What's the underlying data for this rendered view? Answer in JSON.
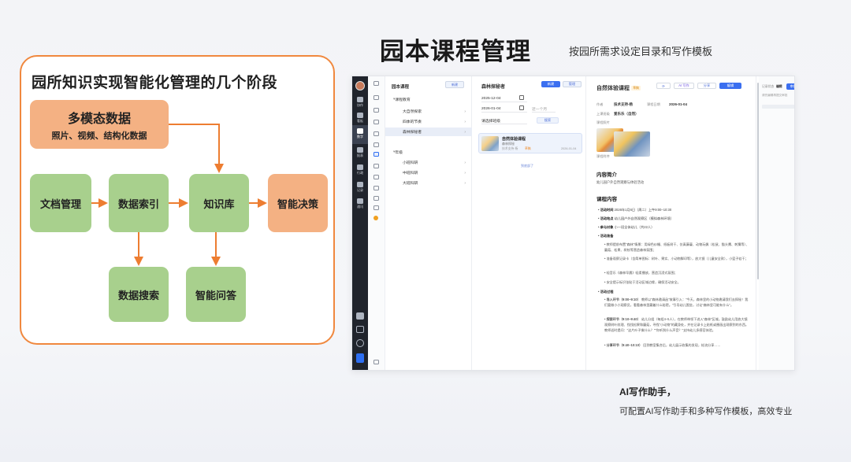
{
  "left_panel": {
    "title": "园所知识实现智能化管理的几个阶段",
    "nodes": {
      "multimodal": {
        "title": "多模态数据",
        "subtitle": "照片、视频、结构化数据"
      },
      "doc_mgmt": "文档管理",
      "data_index": "数据索引",
      "knowledge_base": "知识库",
      "smart_decision": "智能决策",
      "data_search": "数据搜索",
      "smart_qa": "智能问答"
    },
    "colors": {
      "border": "#f0883e",
      "green": "#a8d08d",
      "orange": "#f4b183",
      "arrow": "#ed7d31"
    }
  },
  "header": {
    "title": "园本课程管理",
    "subtitle": "按园所需求设定目录和写作模板"
  },
  "footer": {
    "assistant_title": "AI写作助手，",
    "assistant_desc": "可配置AI写作助手和多种写作模板，高效专业"
  },
  "app": {
    "rail": [
      {
        "label": "协作"
      },
      {
        "label": "看板"
      },
      {
        "label": "数字",
        "active": true
      },
      {
        "label": "报表"
      },
      {
        "label": "行政"
      },
      {
        "label": "记录"
      },
      {
        "label": "通讯"
      }
    ],
    "tree": {
      "title": "园本课程",
      "new_button": "新建",
      "items": [
        {
          "label": "课程教育",
          "level": 0,
          "expanded": true
        },
        {
          "label": "大自然探索",
          "level": 1
        },
        {
          "label": "四季的节奏",
          "level": 1
        },
        {
          "label": "森林探秘者",
          "level": 1,
          "selected": true
        },
        {
          "label": "年级",
          "level": 0,
          "expanded": true
        },
        {
          "label": "小班科研",
          "level": 1
        },
        {
          "label": "中班科研",
          "level": 1
        },
        {
          "label": "大班科研",
          "level": 1
        }
      ]
    },
    "list": {
      "title": "森林探秘者",
      "new_button": "新建",
      "manage_button": "管理",
      "date_start": "2025-12-04",
      "date_end": "2026-01-04",
      "range_select": "近一个月",
      "filter_select": "请选择班级",
      "search_button": "搜索",
      "card": {
        "title": "自然体验课程",
        "subtitle": "森林探秘",
        "author": "技术支持·杨",
        "status": "草稿",
        "date": "2026-01-04"
      },
      "footer_link": "到底部了"
    },
    "detail": {
      "title": "自然体验课程",
      "tag": "草稿",
      "actions": {
        "refresh": "⟳",
        "ai_write": "AI 写作",
        "share": "分享",
        "edit": "编辑"
      },
      "fields": {
        "author_label": "作者",
        "author": "技术支持-杨",
        "created_label": "课程日期",
        "created": "2026-01-04",
        "class_label": "上课班级",
        "class": "爱乐乐（自然）",
        "photo_label": "课程照片",
        "attachment_label": "课程附件"
      },
      "intro_title": "内容简介",
      "intro_text": "幼儿园户外自然观察与体验活动",
      "content_title": "课程内容",
      "bullets": [
        {
          "label": "活动时间",
          "text": "2026年1月6日（周二）上午9:00–10:30"
        },
        {
          "label": "活动地点",
          "text": "幼儿园户外自然观察区（模拟森林环境）"
        },
        {
          "label": "参与对象",
          "text": "小一班全体幼儿（共22人）"
        },
        {
          "label": "活动准备",
          "text": ""
        }
      ],
      "prep": [
        "教师提前布置\"森林\"情景：用绿色纱幔、纸板树干、仿真藤蔓、动物玩偶（松鼠、猫头鹰、刺猬等）、蘑菇、松果、树枝等营造森林氛围；",
        "准备观察记录卡（含简单图标：树叶、果实、小动物脚印等），放大镜（儿童安全款），小篮子若干；",
        "轻音乐《森林早晨》轻柔播放，营造沉浸式氛围；",
        "安全提示标识张贴于活动区域边缘，确保活动安全。"
      ],
      "process_label": "活动过程",
      "steps": [
        {
          "label": "导入环节（9:00–9:10）",
          "text": "教师以\"森林邀请函\"故事引入：\"今天，森林里的小动物邀请我们去探秘！我们要做小小观察员，看看森林里藏着什么秘密。\"引导幼儿围坐，讨论\"森林里可能有什么\"。"
        },
        {
          "label": "探索环节（9:10–9:40）",
          "text": "幼儿分组（每组4–5人），在教师带领下进入\"森林\"区域。鼓励幼儿用放大镜观察树叶纹理、找找松果和蘑菇，寻找\"小动物\"的藏身处，并在记录卡上贴纸或圈画出观察到的东西。教师适时提问：\"这片叶子像什么？\"\"你听到什么声音？\"支持幼儿多感官体验。"
        },
        {
          "label": "分享环节（9:40–10:10）",
          "text": "回到教室集合后，幼儿展示收集的发现，轮流分享……"
        }
      ]
    },
    "ai_panel": {
      "label": "记录状态",
      "value": "编辑",
      "button": "审批流程",
      "hint": "请先编辑再提交审批"
    }
  }
}
